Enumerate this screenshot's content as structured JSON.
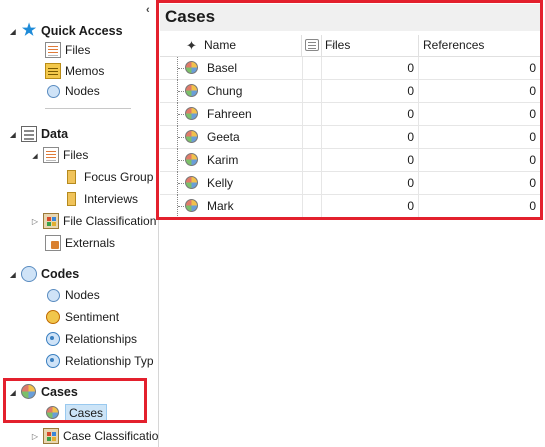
{
  "nav": {
    "quick_access": {
      "label": "Quick Access",
      "items": [
        {
          "label": "Files",
          "icon": "files-icon"
        },
        {
          "label": "Memos",
          "icon": "memos-icon"
        },
        {
          "label": "Nodes",
          "icon": "nodes-icon"
        }
      ]
    },
    "data": {
      "label": "Data",
      "items": [
        {
          "label": "Files",
          "icon": "files-icon"
        },
        {
          "label": "Focus Group",
          "icon": "folder-icon"
        },
        {
          "label": "Interviews",
          "icon": "folder-icon"
        },
        {
          "label": "File Classification",
          "icon": "classification-icon"
        },
        {
          "label": "Externals",
          "icon": "externals-icon"
        }
      ]
    },
    "codes": {
      "label": "Codes",
      "items": [
        {
          "label": "Nodes",
          "icon": "nodes-icon"
        },
        {
          "label": "Sentiment",
          "icon": "sentiment-icon"
        },
        {
          "label": "Relationships",
          "icon": "relationships-icon"
        },
        {
          "label": "Relationship Typ",
          "icon": "relationship-types-icon"
        }
      ]
    },
    "cases": {
      "label": "Cases",
      "items": [
        {
          "label": "Cases",
          "icon": "cases-icon",
          "selected": true
        },
        {
          "label": "Case Classificatio",
          "icon": "classification-icon"
        }
      ]
    }
  },
  "panel": {
    "title": "Cases",
    "columns": {
      "name": "Name",
      "files": "Files",
      "references": "References"
    },
    "rows": [
      {
        "name": "Basel",
        "files": "0",
        "references": "0"
      },
      {
        "name": "Chung",
        "files": "0",
        "references": "0"
      },
      {
        "name": "Fahreen",
        "files": "0",
        "references": "0"
      },
      {
        "name": "Geeta",
        "files": "0",
        "references": "0"
      },
      {
        "name": "Karim",
        "files": "0",
        "references": "0"
      },
      {
        "name": "Kelly",
        "files": "0",
        "references": "0"
      },
      {
        "name": "Mark",
        "files": "0",
        "references": "0"
      }
    ]
  },
  "colors": {
    "highlight": "#e3202d",
    "selected_bg": "#cce4f7",
    "accent": "#1e8bd8"
  }
}
